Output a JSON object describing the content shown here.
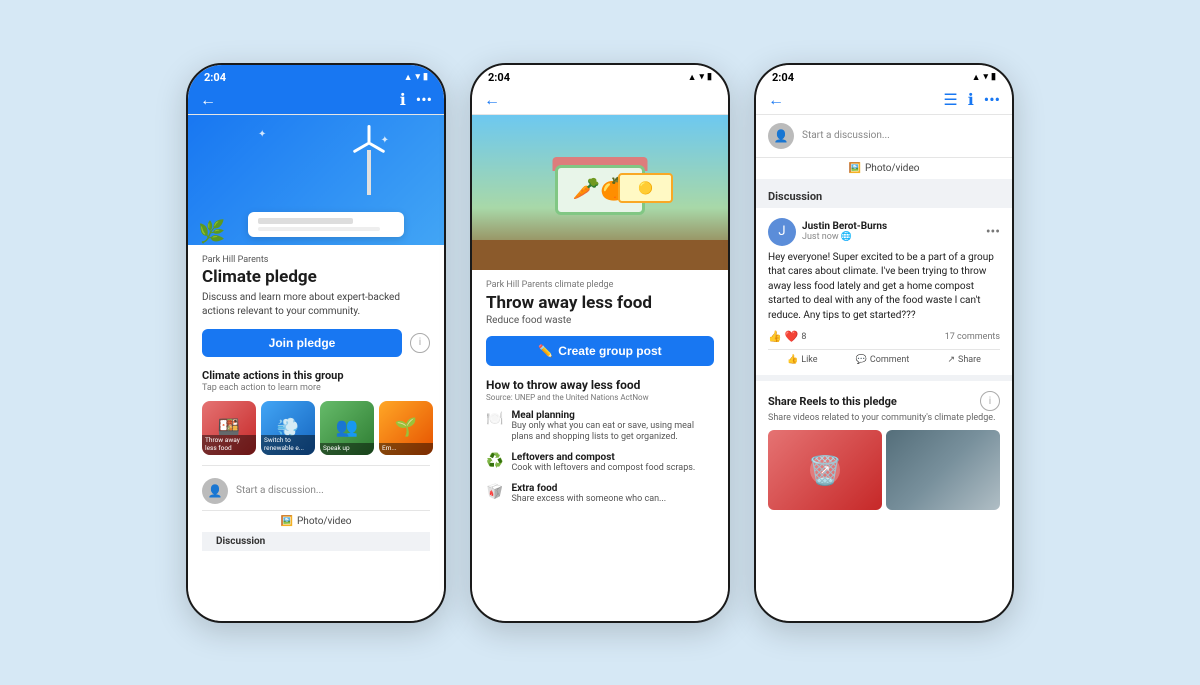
{
  "background_color": "#d6e8f5",
  "phone1": {
    "status_time": "2:04",
    "group_name": "Park Hill Parents",
    "pledge_title": "Climate pledge",
    "pledge_desc": "Discuss and learn more about expert-backed actions relevant to your community.",
    "join_btn_label": "Join pledge",
    "info_label": "i",
    "climate_actions_title": "Climate actions in this group",
    "climate_actions_sub": "Tap each action to learn more",
    "tiles": [
      {
        "label": "Throw away less food",
        "emoji": "🍱",
        "bg": "#e57373"
      },
      {
        "label": "Switch to renewable e...",
        "emoji": "💨",
        "bg": "#42a5f5"
      },
      {
        "label": "Speak up",
        "emoji": "👥",
        "bg": "#66bb6a"
      },
      {
        "label": "Em...",
        "emoji": "🌱",
        "bg": "#ffa726"
      }
    ],
    "start_discussion": "Start a discussion...",
    "photo_video": "Photo/video",
    "discussion_label": "Discussion"
  },
  "phone2": {
    "status_time": "2:04",
    "pledge_sub": "Park Hill Parents climate pledge",
    "action_title": "Throw away less food",
    "action_subtitle": "Reduce food waste",
    "create_post_label": "Create group post",
    "how_to_title": "How to throw away less food",
    "how_to_source": "Source: UNEP and the United Nations ActNow",
    "items": [
      {
        "icon": "🍽️",
        "title": "Meal planning",
        "desc": "Buy only what you can eat or save, using meal plans and shopping lists to get organized."
      },
      {
        "icon": "♻️",
        "title": "Leftovers and compost",
        "desc": "Cook with leftovers and compost food scraps."
      },
      {
        "icon": "🥡",
        "title": "Extra food",
        "desc": "Share excess with someone who can..."
      }
    ]
  },
  "phone3": {
    "status_time": "2:04",
    "start_discussion": "Start a discussion...",
    "photo_video": "Photo/video",
    "discussion_label": "Discussion",
    "post": {
      "author": "Justin Berot-Burns",
      "time": "Just now",
      "text": "Hey everyone! Super excited to be a part of a group that cares about climate. I've been trying to throw away less food lately and get a home compost started to deal with any of the food waste I can't reduce. Any tips to get started???",
      "reactions": "8",
      "comments": "17 comments",
      "like_label": "Like",
      "comment_label": "Comment",
      "share_label": "Share"
    },
    "reels": {
      "title": "Share Reels to this pledge",
      "desc": "Share videos related to your community's climate pledge."
    }
  }
}
